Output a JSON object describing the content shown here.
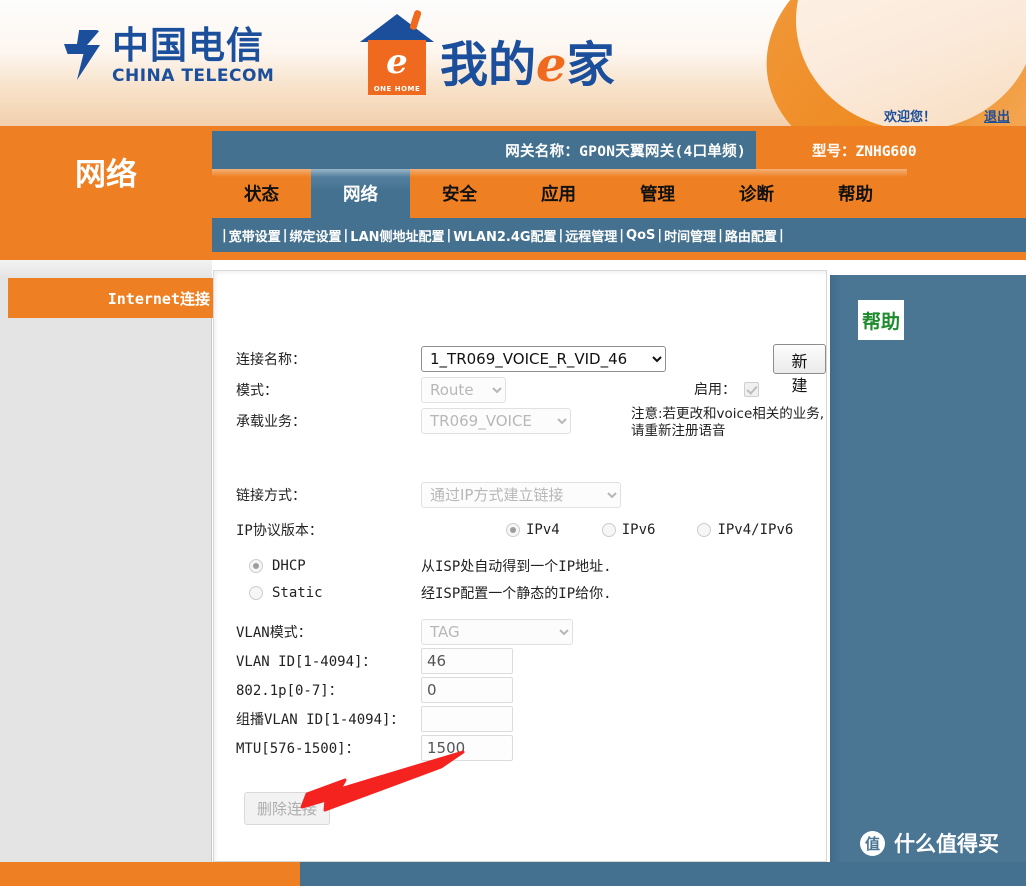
{
  "banner": {
    "telecom_cn": "中国电信",
    "telecom_en": "CHINA TELECOM",
    "ehome_e": "e",
    "ehome_tag": "ONE HOME",
    "ehome_text_1": "我的",
    "ehome_text_2": "e",
    "ehome_text_3": "家",
    "welcome": "欢迎您！",
    "logout": "退出"
  },
  "nav": {
    "brand": "网络",
    "gateway_name": "网关名称：GPON天翼网关(4口单频)",
    "model": "型号：ZNHG600",
    "tabs": [
      {
        "label": "状态",
        "active": false
      },
      {
        "label": "网络",
        "active": true
      },
      {
        "label": "安全",
        "active": false
      },
      {
        "label": "应用",
        "active": false
      },
      {
        "label": "管理",
        "active": false
      },
      {
        "label": "诊断",
        "active": false
      },
      {
        "label": "帮助",
        "active": false
      }
    ],
    "subnav": [
      "宽带设置",
      "绑定设置",
      "LAN侧地址配置",
      "WLAN2.4G配置",
      "远程管理",
      "QoS",
      "时间管理",
      "路由配置"
    ]
  },
  "sidebar": {
    "items": [
      {
        "label": "Internet连接"
      }
    ]
  },
  "help": {
    "title": "帮助"
  },
  "form": {
    "conn_name_label": "连接名称：",
    "conn_name_value": "1_TR069_VOICE_R_VID_46",
    "new_button": "新建",
    "mode_label": "模式：",
    "mode_value": "Route",
    "enable_label": "启用：",
    "service_label": "承载业务：",
    "service_value": "TR069_VOICE",
    "note": "注意:若更改和voice相关的业务,请重新注册语音",
    "link_mode_label": "链接方式：",
    "link_mode_value": "通过IP方式建立链接",
    "ipver_label": "IP协议版本：",
    "ipver_options": [
      {
        "label": "IPv4",
        "selected": true
      },
      {
        "label": "IPv6",
        "selected": false
      },
      {
        "label": "IPv4/IPv6",
        "selected": false
      }
    ],
    "addr_modes": [
      {
        "label": "DHCP",
        "selected": true,
        "desc": "从ISP处自动得到一个IP地址."
      },
      {
        "label": "Static",
        "selected": false,
        "desc": "经ISP配置一个静态的IP给你."
      }
    ],
    "vlan_mode_label": "VLAN模式：",
    "vlan_mode_value": "TAG",
    "vlan_id_label": "VLAN ID[1-4094]：",
    "vlan_id_value": "46",
    "pbit_label": "802.1p[0-7]：",
    "pbit_value": "0",
    "mcast_vlan_label": "组播VLAN ID[1-4094]：",
    "mcast_vlan_value": "",
    "mtu_label": "MTU[576-1500]：",
    "mtu_value": "1500",
    "delete_button": "删除连接"
  },
  "watermark": {
    "mark": "值",
    "text": "什么值得买"
  },
  "colors": {
    "orange": "#ee8023",
    "blue": "#44718f",
    "brand_blue": "#1b4f9c",
    "arrow_red": "#f5231f",
    "help_green": "#1e8c2e"
  }
}
